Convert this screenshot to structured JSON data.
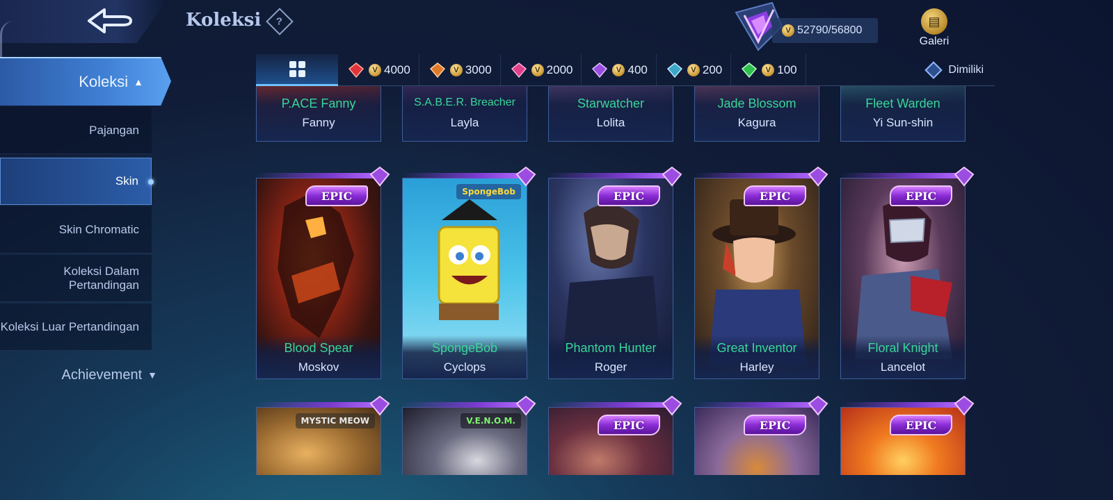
{
  "header": {
    "title": "Koleksi",
    "points_current": "52790",
    "points_total": "56800",
    "galeri_label": "Galeri"
  },
  "sidebar": {
    "main_label": "Koleksi",
    "items": [
      {
        "label": "Pajangan"
      },
      {
        "label": "Skin"
      },
      {
        "label": "Skin Chromatic"
      },
      {
        "label": "Koleksi Dalam Pertandingan"
      },
      {
        "label": "Koleksi Luar Pertandingan"
      }
    ],
    "achievement_label": "Achievement"
  },
  "filters": {
    "tiers": [
      {
        "value": "4000",
        "color": "#e0343a"
      },
      {
        "value": "3000",
        "color": "#e07a2a"
      },
      {
        "value": "2000",
        "color": "#e0408a"
      },
      {
        "value": "400",
        "color": "#9a4de0"
      },
      {
        "value": "200",
        "color": "#3aa6c8"
      },
      {
        "value": "100",
        "color": "#2fbf4f"
      }
    ],
    "owned_label": "Dimiliki"
  },
  "cards_top": [
    {
      "skin": "P.ACE Fanny",
      "hero": "Fanny"
    },
    {
      "skin": "S.A.B.E.R. Breacher",
      "hero": "Layla"
    },
    {
      "skin": "Starwatcher",
      "hero": "Lolita"
    },
    {
      "skin": "Jade Blossom",
      "hero": "Kagura"
    },
    {
      "skin": "Fleet Warden",
      "hero": "Yi Sun-shin"
    }
  ],
  "cards_mid": [
    {
      "skin": "Blood Spear",
      "hero": "Moskov",
      "badge": "EPIC"
    },
    {
      "skin": "SpongeBob",
      "hero": "Cyclops",
      "badge": ""
    },
    {
      "skin": "Phantom Hunter",
      "hero": "Roger",
      "badge": "EPIC"
    },
    {
      "skin": "Great Inventor",
      "hero": "Harley",
      "badge": "EPIC"
    },
    {
      "skin": "Floral Knight",
      "hero": "Lancelot",
      "badge": "EPIC"
    }
  ],
  "cards_bottom": [
    {
      "badge": ""
    },
    {
      "badge": ""
    },
    {
      "badge": "EPIC"
    },
    {
      "badge": "EPIC"
    },
    {
      "badge": "EPIC"
    }
  ]
}
